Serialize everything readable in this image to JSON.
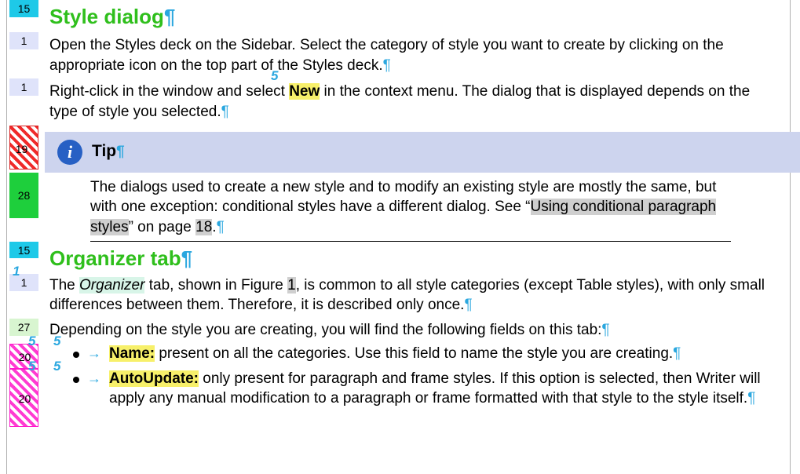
{
  "gutter": {
    "r1": "15",
    "r2": "1",
    "r3": "1",
    "r4": "19",
    "r5": "28",
    "r6": "15",
    "r7": "1",
    "r8": "27",
    "r9": "20",
    "r10": "20"
  },
  "annotations": {
    "new_above": "5",
    "org_above": "1",
    "b1a": "5",
    "b1b": "5",
    "b2a": "5",
    "b2b": "5"
  },
  "heading1": "Style dialog",
  "p1": "Open the Styles deck on the Sidebar. Select the category of style you want to create by clicking on the appropriate icon on the top part of the Styles deck.",
  "p2a": "Right-click in the window and select ",
  "p2_new": "New",
  "p2b": " in the context menu. The dialog that is displayed depends on the type of style you selected.",
  "tip_label": "Tip",
  "tip_body_a": "The dialogs used to create a new style and to modify an existing style are mostly the same, but with one exception: conditional styles have a different dialog. See “",
  "tip_link": "Using conditional paragraph styles",
  "tip_body_b": "” on page ",
  "tip_page": "18",
  "tip_body_c": ".",
  "heading2": "Organizer tab",
  "p3a": "The ",
  "p3_org": "Organizer",
  "p3b": " tab, shown in Figure ",
  "p3_fig": "1",
  "p3c": ", is common to all style categories (except Table styles), with only small differences between them. Therefore, it is described only once.",
  "p4": "Depending on the style you are creating, you will find the following fields on this tab:",
  "b1_name": "Name:",
  "b1_text": " present on all the categories. Use this field to name the style you are creating.",
  "b2_name": "AutoUpdate:",
  "b2_text": " only present for paragraph and frame styles. If this option is selected, then Writer will apply any manual modification to a paragraph or frame formatted with that style to the style itself.",
  "pilcrow": "¶",
  "arrow": "→"
}
